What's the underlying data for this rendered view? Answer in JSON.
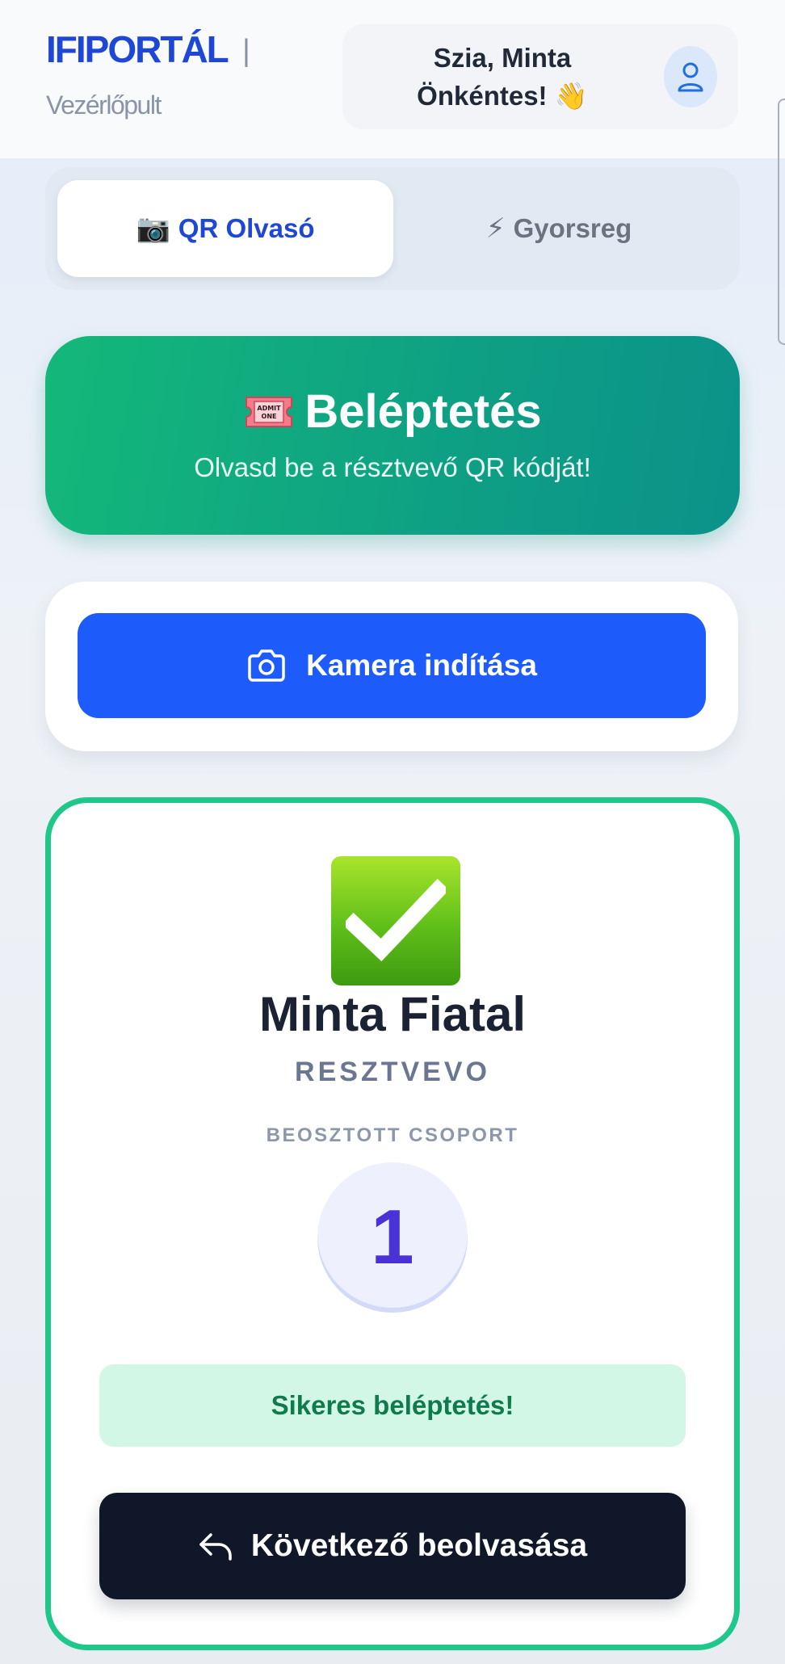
{
  "header": {
    "brand": "IFIPORTÁL",
    "separator": "|",
    "subtitle": "Vezérlőpult",
    "greeting_line1": "Szia, Minta",
    "greeting_line2": "Önkéntes! 👋"
  },
  "tabs": [
    {
      "icon": "📷",
      "label": "QR Olvasó",
      "active": true
    },
    {
      "icon": "⚡",
      "label": "Gyorsreg",
      "active": false
    }
  ],
  "hero": {
    "ticket_text_1": "ADMIT",
    "ticket_text_2": "ONE",
    "title": "Beléptetés",
    "subtitle": "Olvasd be a résztvevő QR kódját!"
  },
  "camera": {
    "button_label": "Kamera indítása"
  },
  "result": {
    "name": "Minta Fiatal",
    "role": "RESZTVEVO",
    "group_label": "BEOSZTOTT CSOPORT",
    "group_number": "1",
    "status_message": "Sikeres beléptetés!",
    "next_button_label": "Következő beolvasása"
  },
  "colors": {
    "brand": "#1f47d6",
    "success_border": "#1fc88a",
    "camera_button": "#1d5cfb",
    "dark_button": "#0f1729",
    "group_number": "#4a33d6"
  }
}
